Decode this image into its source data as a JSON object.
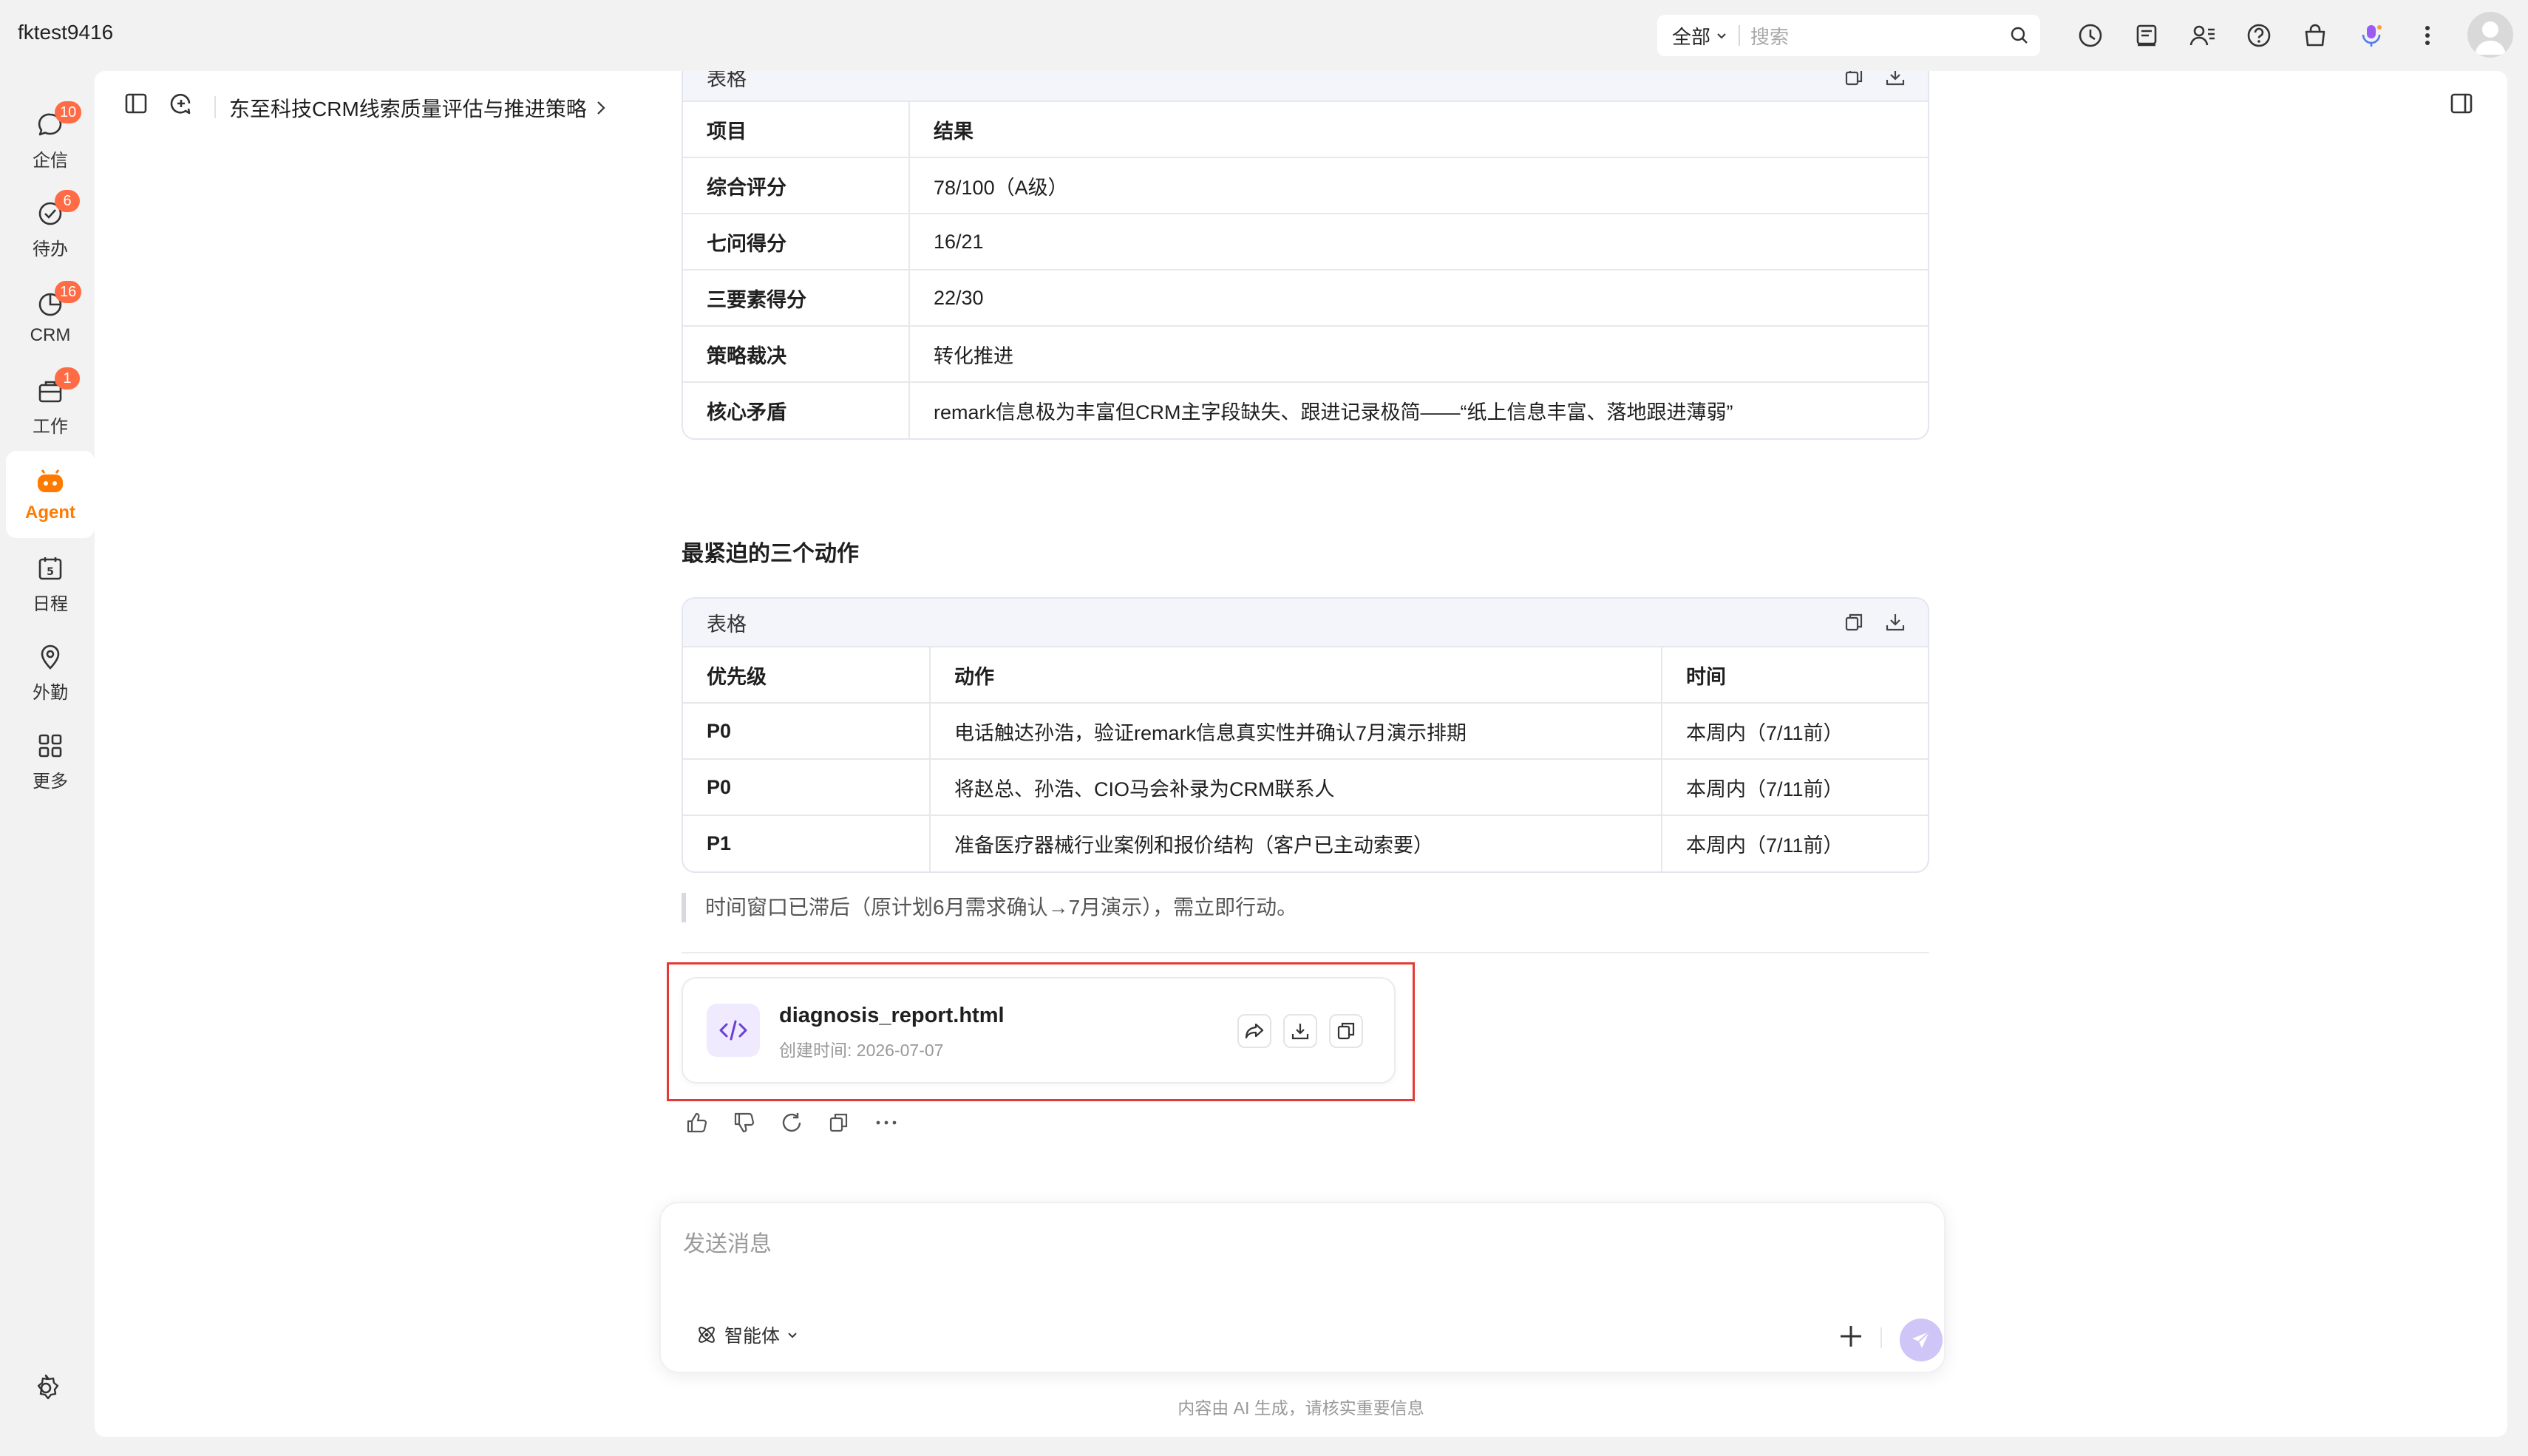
{
  "topbar": {
    "username": "fktest9416",
    "search_scope": "全部",
    "search_placeholder": "搜索",
    "icons": [
      "history-icon",
      "notes-icon",
      "contacts-icon",
      "help-icon",
      "shop-icon",
      "voice-assistant-icon",
      "more-vertical-icon"
    ]
  },
  "sidebar": {
    "items": [
      {
        "label": "企信",
        "badge": "10",
        "icon": "chat-icon"
      },
      {
        "label": "待办",
        "badge": "6",
        "icon": "todo-icon"
      },
      {
        "label": "CRM",
        "badge": "16",
        "icon": "crm-icon"
      },
      {
        "label": "工作",
        "badge": "1",
        "icon": "work-icon"
      },
      {
        "label": "Agent",
        "badge": "",
        "icon": "agent-icon",
        "active": true
      },
      {
        "label": "日程",
        "badge": "",
        "icon": "calendar-icon"
      },
      {
        "label": "外勤",
        "badge": "",
        "icon": "location-icon"
      },
      {
        "label": "更多",
        "badge": "",
        "icon": "grid-icon"
      }
    ]
  },
  "header": {
    "breadcrumb": "东至科技CRM线索质量评估与推进策略"
  },
  "table1": {
    "title": "表格",
    "columns": [
      "项目",
      "结果"
    ],
    "rows": [
      [
        "综合评分",
        "78/100（A级）"
      ],
      [
        "七问得分",
        "16/21"
      ],
      [
        "三要素得分",
        "22/30"
      ],
      [
        "策略裁决",
        "转化推进"
      ],
      [
        "核心矛盾",
        "remark信息极为丰富但CRM主字段缺失、跟进记录极简——“纸上信息丰富、落地跟进薄弱”"
      ]
    ]
  },
  "section_heading": "最紧迫的三个动作",
  "table2": {
    "title": "表格",
    "columns": [
      "优先级",
      "动作",
      "时间"
    ],
    "rows": [
      [
        "P0",
        "电话触达孙浩，验证remark信息真实性并确认7月演示排期",
        "本周内（7/11前）"
      ],
      [
        "P0",
        "将赵总、孙浩、CIO马会补录为CRM联系人",
        "本周内（7/11前）"
      ],
      [
        "P1",
        "准备医疗器械行业案例和报价结构（客户已主动索要）",
        "本周内（7/11前）"
      ]
    ]
  },
  "quote": "时间窗口已滞后（原计划6月需求确认→7月演示），需立即行动。",
  "file": {
    "name": "diagnosis_report.html",
    "created": "创建时间: 2026-07-07"
  },
  "composer": {
    "placeholder": "发送消息",
    "agent_label": "智能体"
  },
  "disclaimer": "内容由 AI 生成，请核实重要信息",
  "colors": {
    "accent": "#ff7a00",
    "badge": "#ff6b45",
    "highlight_box": "#e53935",
    "send_button": "#cfc5f7"
  }
}
